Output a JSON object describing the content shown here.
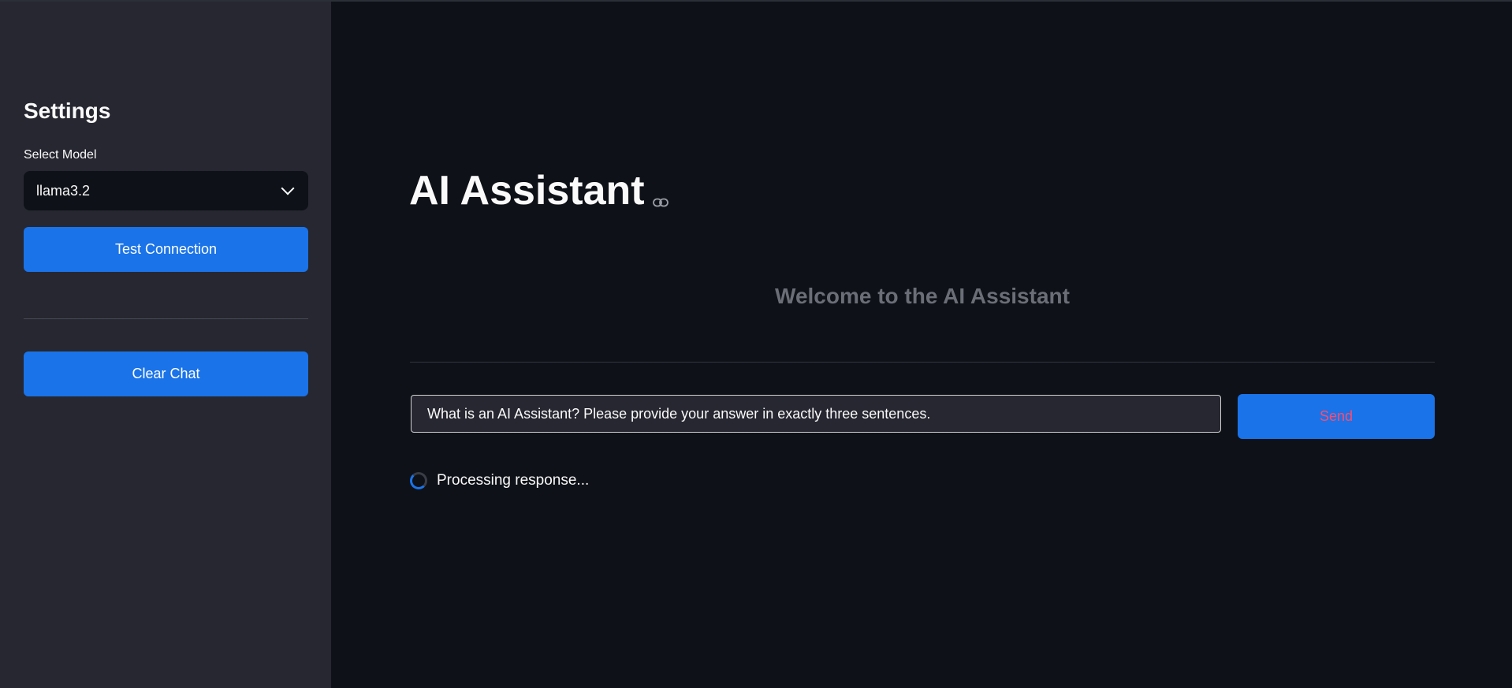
{
  "sidebar": {
    "title": "Settings",
    "model_label": "Select Model",
    "model_value": "llama3.2",
    "test_button": "Test Connection",
    "clear_button": "Clear Chat"
  },
  "main": {
    "title": "AI Assistant",
    "welcome": "Welcome to the AI Assistant",
    "input_value": "What is an AI Assistant? Please provide your answer in exactly three sentences.",
    "send_button": "Send",
    "status": "Processing response..."
  },
  "colors": {
    "background": "#0e1117",
    "sidebar": "#262730",
    "accent": "#1a73e8",
    "send_text": "#ff4b6e"
  },
  "icons": {
    "title_link": "link-icon",
    "select_chevron": "chevron-down-icon",
    "status": "spinner-icon"
  }
}
